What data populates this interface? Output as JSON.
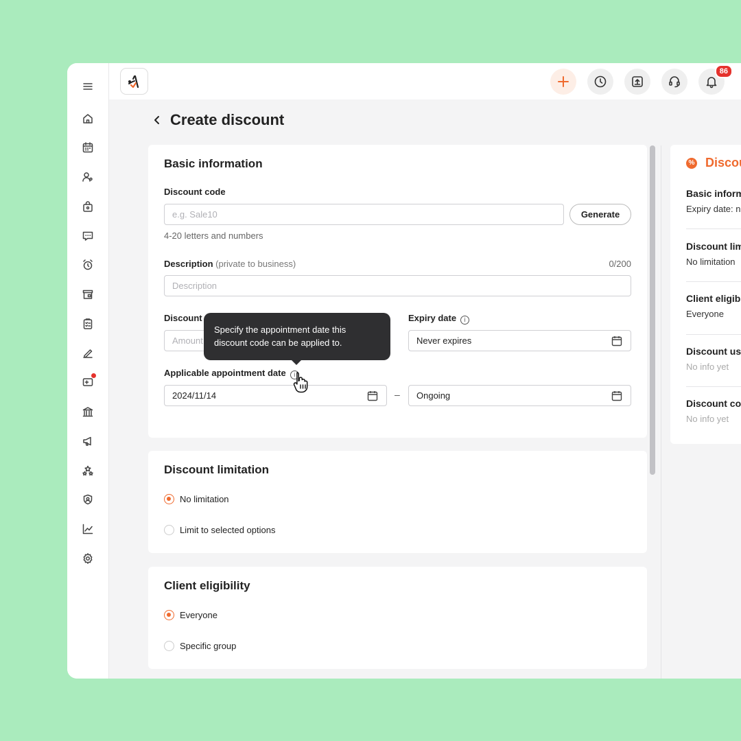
{
  "topbar": {
    "notification_count": "86"
  },
  "page": {
    "title": "Create discount"
  },
  "basic": {
    "title": "Basic information",
    "code_label": "Discount code",
    "code_placeholder": "e.g. Sale10",
    "generate_label": "Generate",
    "code_hint": "4-20 letters and numbers",
    "desc_label": "Description",
    "desc_sub": "(private to business)",
    "desc_counter": "0/200",
    "desc_placeholder": "Description",
    "amount_label": "Discount",
    "amount_placeholder": "Amount",
    "expiry_label": "Expiry date",
    "expiry_value": "Never expires",
    "appt_label": "Applicable appointment date",
    "appt_start": "2024/11/14",
    "appt_dash": "–",
    "appt_end": "Ongoing",
    "tooltip": "Specify the appointment date this discount code can be applied to."
  },
  "limitation": {
    "title": "Discount limitation",
    "options": [
      "No limitation",
      "Limit to selected options"
    ]
  },
  "eligibility": {
    "title": "Client eligibility",
    "options": [
      "Everyone",
      "Specific group"
    ]
  },
  "summary": {
    "title": "Discount summary",
    "sections": [
      {
        "title": "Basic information",
        "value": "Expiry date: never expires"
      },
      {
        "title": "Discount limitation",
        "value": "No limitation"
      },
      {
        "title": "Client eligibility",
        "value": "Everyone"
      },
      {
        "title": "Discount usage",
        "value": "No info yet"
      },
      {
        "title": "Discount code",
        "value": "No info yet"
      }
    ]
  },
  "colors": {
    "accent": "#ef6a2e",
    "background": "#aaebbd",
    "badge": "#e5322d"
  }
}
